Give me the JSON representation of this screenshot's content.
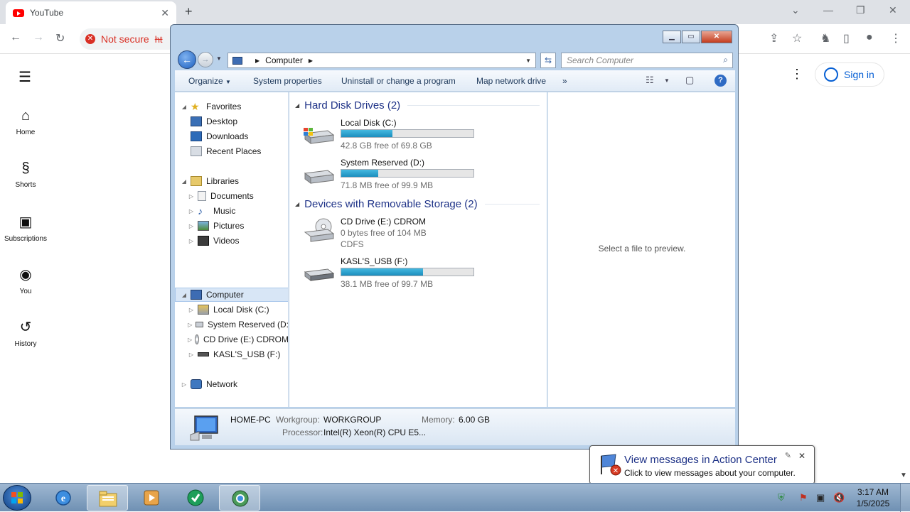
{
  "browser": {
    "tab_title": "YouTube",
    "tab_close": "✕",
    "new_tab": "+",
    "security_label": "Not secure",
    "url_fragment": "ht"
  },
  "youtube": {
    "nav": [
      {
        "label": "Home",
        "icon": "home-icon"
      },
      {
        "label": "Shorts",
        "icon": "shorts-icon"
      },
      {
        "label": "Subscriptions",
        "icon": "subscriptions-icon"
      },
      {
        "label": "You",
        "icon": "you-icon"
      },
      {
        "label": "History",
        "icon": "history-icon"
      }
    ],
    "sign_in": "Sign in"
  },
  "explorer": {
    "address": {
      "crumb": "Computer"
    },
    "search_placeholder": "Search Computer",
    "commands": {
      "organize": "Organize",
      "system_properties": "System properties",
      "uninstall": "Uninstall or change a program",
      "map_drive": "Map network drive",
      "more": "»"
    },
    "nav_pane": {
      "favorites": "Favorites",
      "desktop": "Desktop",
      "downloads": "Downloads",
      "recent": "Recent Places",
      "libraries": "Libraries",
      "documents": "Documents",
      "music": "Music",
      "pictures": "Pictures",
      "videos": "Videos",
      "computer": "Computer",
      "local_disk": "Local Disk (C:)",
      "system_reserved": "System Reserved (D:",
      "cd_drive": "CD Drive (E:) CDROM",
      "usb": "KASL'S_USB (F:)",
      "network": "Network"
    },
    "groups": {
      "hdd": "Hard Disk Drives (2)",
      "removable": "Devices with Removable Storage (2)"
    },
    "drives": {
      "c": {
        "name": "Local Disk (C:)",
        "info": "42.8 GB free of 69.8 GB",
        "used_fraction": 0.387
      },
      "d": {
        "name": "System Reserved (D:)",
        "info": "71.8 MB free of 99.9 MB",
        "used_fraction": 0.281
      },
      "e": {
        "name": "CD Drive (E:) CDROM",
        "info": "0 bytes free of 104 MB",
        "fs": "CDFS"
      },
      "f": {
        "name": "KASL'S_USB (F:)",
        "info": "38.1 MB free of 99.7 MB",
        "used_fraction": 0.618
      }
    },
    "preview_text": "Select a file to preview.",
    "details": {
      "pc_name": "HOME-PC",
      "workgroup_label": "Workgroup:",
      "workgroup": "WORKGROUP",
      "memory_label": "Memory:",
      "memory": "6.00 GB",
      "processor_label": "Processor:",
      "processor": "Intel(R) Xeon(R) CPU E5..."
    }
  },
  "notification": {
    "title": "View messages in Action Center",
    "subtitle": "Click to view messages about your computer."
  },
  "taskbar": {
    "time": "3:17 AM",
    "date": "1/5/2025"
  }
}
